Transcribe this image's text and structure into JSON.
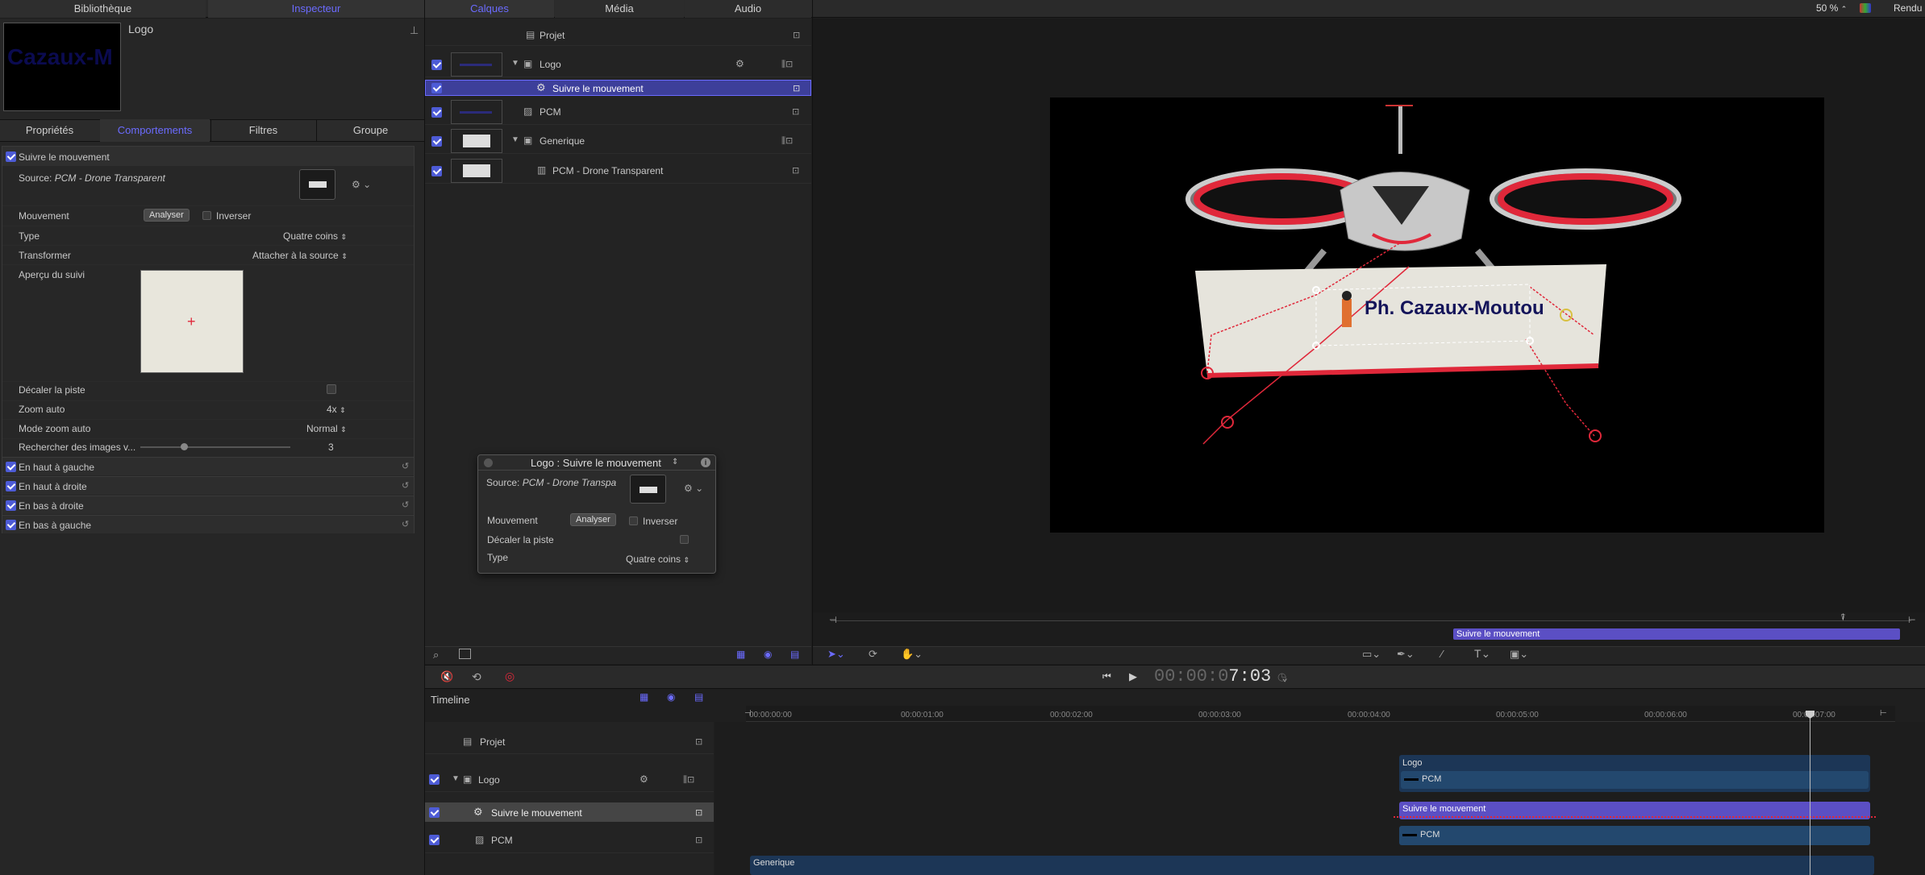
{
  "top_tabs": {
    "library": "Bibliothèque",
    "inspector": "Inspecteur",
    "layers": "Calques",
    "media": "Média",
    "audio": "Audio",
    "zoom": "50 %",
    "render": "Rendu"
  },
  "preview": {
    "object_name": "Logo",
    "thumb_text": "Cazaux-M"
  },
  "inspector_tabs": [
    "Propriétés",
    "Comportements",
    "Filtres",
    "Groupe"
  ],
  "behavior": {
    "title": "Suivre le mouvement",
    "source_label": "Source:",
    "source_value": "PCM - Drone Transparent",
    "movement_label": "Mouvement",
    "analyze_button": "Analyser",
    "invert_label": "Inverser",
    "type_label": "Type",
    "type_value": "Quatre coins",
    "transform_label": "Transformer",
    "transform_value": "Attacher à la source",
    "preview_label": "Aperçu du suivi",
    "offset_label": "Décaler la piste",
    "autozoom_label": "Zoom auto",
    "autozoom_value": "4x",
    "autozoom_mode_label": "Mode zoom auto",
    "autozoom_mode_value": "Normal",
    "search_label": "Rechercher des images v...",
    "search_value": "3",
    "corners": [
      "En haut à gauche",
      "En haut à droite",
      "En bas à droite",
      "En bas à gauche"
    ]
  },
  "layers": [
    {
      "name": "Projet"
    },
    {
      "name": "Logo"
    },
    {
      "name": "Suivre le mouvement"
    },
    {
      "name": "PCM"
    },
    {
      "name": "Generique"
    },
    {
      "name": "PCM - Drone Transparent"
    }
  ],
  "hud": {
    "title": "Logo : Suivre le mouvement",
    "source_label": "Source:",
    "source_value": "PCM - Drone Transpa",
    "movement_label": "Mouvement",
    "analyze_button": "Analyser",
    "invert_label": "Inverser",
    "offset_label": "Décaler la piste",
    "type_label": "Type",
    "type_value": "Quatre coins"
  },
  "canvas": {
    "banner_text": "Ph. Cazaux-Moutou",
    "mini_track_label": "Suivre le mouvement"
  },
  "transport": {
    "timecode_dim": "00:00:0",
    "timecode_bright": "7:03"
  },
  "timeline": {
    "label": "Timeline",
    "ruler": [
      "00:00:00:00",
      "00:00:01:00",
      "00:00:02:00",
      "00:00:03:00",
      "00:00:04:00",
      "00:00:05:00",
      "00:00:06:00",
      "00:00:07:00"
    ],
    "rows": [
      {
        "name": "Projet"
      },
      {
        "name": "Logo"
      },
      {
        "name": "Suivre le mouvement"
      },
      {
        "name": "PCM"
      }
    ],
    "tracks": {
      "logo": "Logo",
      "pcm1": "PCM",
      "behavior": "Suivre le mouvement",
      "pcm2": "PCM",
      "generique": "Generique"
    }
  },
  "colors": {
    "accent": "#6b6bff",
    "selection": "#3d3f9a",
    "behavior_track": "#5b4fc4",
    "layer_track": "#23486e",
    "tracker_red": "#e0283a"
  }
}
